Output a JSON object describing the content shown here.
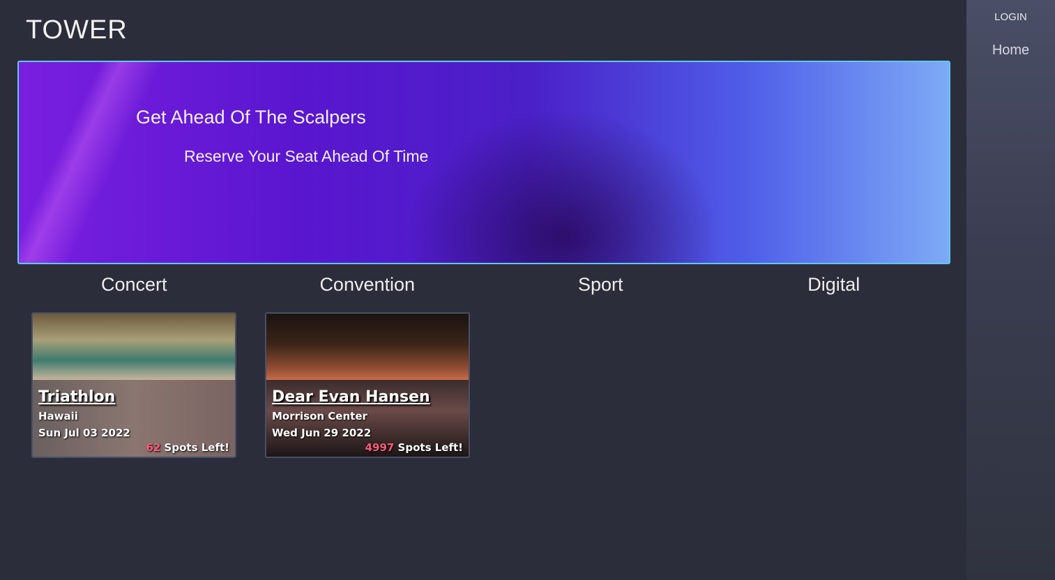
{
  "brand": "TOWER",
  "nav": {
    "login": "LOGIN",
    "home": "Home"
  },
  "hero": {
    "title": "Get Ahead Of The Scalpers",
    "subtitle": "Reserve Your Seat Ahead Of Time"
  },
  "categories": [
    "Concert",
    "Convention",
    "Sport",
    "Digital"
  ],
  "events": [
    {
      "name": "Triathlon",
      "location": "Hawaii",
      "date": "Sun Jul 03 2022",
      "spots": "62",
      "spots_label": " Spots Left!"
    },
    {
      "name": "Dear Evan Hansen",
      "location": "Morrison Center",
      "date": "Wed Jun 29 2022",
      "spots": "4997",
      "spots_label": " Spots Left!"
    }
  ],
  "colors": {
    "accent": "#ff5a78",
    "hero_border": "#5fc8f0",
    "background": "#2b2d3a"
  }
}
